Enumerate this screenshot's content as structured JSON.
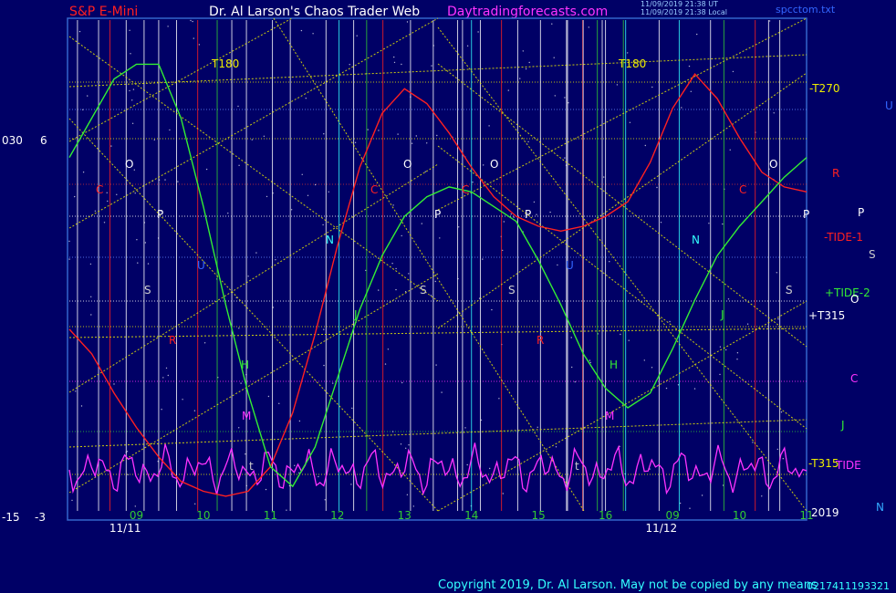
{
  "header": {
    "symbol": "S&P E-Mini",
    "title": "Dr. Al Larson's Chaos Trader Web",
    "site": "Daytradingforecasts.com",
    "stamp1": "11/09/2019 21:38 UT",
    "stamp2": "11/09/2019 21:38 Local",
    "file": "spcctom.txt",
    "copyright": "Copyright 2019, Dr. Al Larson. May not be copied by any means",
    "serial": "0217411193321"
  },
  "colors": {
    "background": "#000066",
    "frame": "#3366cc",
    "grid": "#ffffff",
    "red": "#ff2020",
    "green": "#33ee33",
    "magenta": "#ff33ff",
    "yellow": "#eeee00",
    "cyan": "#33ffff",
    "white": "#ffffff"
  },
  "chart_data": {
    "type": "line",
    "xlim": [
      0,
      33
    ],
    "ylim": [
      -3,
      7
    ],
    "axis_left_outer": [
      "030",
      "-15"
    ],
    "axis_left_inner": [
      "6",
      "-3"
    ],
    "x_ticks": [
      {
        "x": 3,
        "label": "09"
      },
      {
        "x": 6,
        "label": "10"
      },
      {
        "x": 9,
        "label": "11"
      },
      {
        "x": 12,
        "label": "12"
      },
      {
        "x": 15,
        "label": "13"
      },
      {
        "x": 18,
        "label": "14"
      },
      {
        "x": 21,
        "label": "15"
      },
      {
        "x": 24,
        "label": "16"
      },
      {
        "x": 27,
        "label": "09"
      },
      {
        "x": 30,
        "label": "10"
      },
      {
        "x": 33,
        "label": "11"
      }
    ],
    "date_labels": [
      {
        "x": 2.5,
        "label": "11/11"
      },
      {
        "x": 26.5,
        "label": "11/12"
      }
    ],
    "year_label": "2019",
    "series": [
      {
        "name": "TIDE-1",
        "color": "#ff2020",
        "x": [
          0,
          1,
          2,
          3,
          4,
          5,
          6,
          7,
          8,
          9,
          10,
          11,
          12,
          13,
          14,
          15,
          16,
          17,
          18,
          19,
          20,
          21,
          22,
          23,
          24,
          25,
          26,
          27,
          28,
          29,
          30,
          31,
          32,
          33
        ],
        "y": [
          0.7,
          0.2,
          -0.6,
          -1.3,
          -1.9,
          -2.4,
          -2.6,
          -2.7,
          -2.6,
          -2.1,
          -1.0,
          0.6,
          2.4,
          4.0,
          5.1,
          5.6,
          5.3,
          4.7,
          4.0,
          3.4,
          3.0,
          2.8,
          2.7,
          2.8,
          3.0,
          3.3,
          4.1,
          5.2,
          5.9,
          5.4,
          4.6,
          3.9,
          3.6,
          3.5
        ]
      },
      {
        "name": "TIDE-2",
        "color": "#33ee33",
        "x": [
          0,
          1,
          2,
          3,
          4,
          5,
          6,
          7,
          8,
          9,
          10,
          11,
          12,
          13,
          14,
          15,
          16,
          17,
          18,
          19,
          20,
          21,
          22,
          23,
          24,
          25,
          26,
          27,
          28,
          29,
          30,
          31,
          32,
          33
        ],
        "y": [
          4.2,
          5.0,
          5.8,
          6.1,
          6.1,
          5.0,
          3.2,
          1.2,
          -0.6,
          -2.1,
          -2.5,
          -1.7,
          -0.3,
          1.1,
          2.2,
          3.0,
          3.4,
          3.6,
          3.5,
          3.2,
          2.9,
          2.1,
          1.2,
          0.2,
          -0.5,
          -0.9,
          -0.6,
          0.3,
          1.3,
          2.2,
          2.8,
          3.3,
          3.8,
          4.2
        ]
      }
    ],
    "tide_label": "TIDE",
    "right_labels": [
      {
        "text": "-T270",
        "color": "#eeee00"
      },
      {
        "text": "U",
        "color": "#3366ff"
      },
      {
        "text": "R",
        "color": "#ff2020"
      },
      {
        "text": "P",
        "color": "#ffffff"
      },
      {
        "text": "-TIDE-1",
        "color": "#ff2020"
      },
      {
        "text": "S",
        "color": "#cccccc"
      },
      {
        "text": "+TIDE-2",
        "color": "#33ee33"
      },
      {
        "text": "O",
        "color": "#ffffff"
      },
      {
        "text": "+T315",
        "color": "#ffffff"
      },
      {
        "text": "C",
        "color": "#ff33ff"
      },
      {
        "text": "J",
        "color": "#33ee33"
      },
      {
        "text": "-T315",
        "color": "#eeee00"
      },
      {
        "text": "N",
        "color": "#33aaff"
      }
    ],
    "markers": [
      {
        "text": "T180",
        "color": "#eeee00"
      },
      {
        "text": "T180",
        "color": "#eeee00"
      },
      {
        "text": "O",
        "color": "#ffffff"
      },
      {
        "text": "O",
        "color": "#ffffff"
      },
      {
        "text": "O",
        "color": "#ffffff"
      },
      {
        "text": "O",
        "color": "#ffffff"
      },
      {
        "text": "P",
        "color": "#ffffff"
      },
      {
        "text": "P",
        "color": "#ffffff"
      },
      {
        "text": "P",
        "color": "#ffffff"
      },
      {
        "text": "P",
        "color": "#ffffff"
      },
      {
        "text": "S",
        "color": "#cccccc"
      },
      {
        "text": "S",
        "color": "#cccccc"
      },
      {
        "text": "S",
        "color": "#cccccc"
      },
      {
        "text": "S",
        "color": "#cccccc"
      },
      {
        "text": "C",
        "color": "#ff2020"
      },
      {
        "text": "C",
        "color": "#ff2020"
      },
      {
        "text": "C",
        "color": "#ff2020"
      },
      {
        "text": "C",
        "color": "#ff2020"
      },
      {
        "text": "R",
        "color": "#ff2020"
      },
      {
        "text": "R",
        "color": "#ff2020"
      },
      {
        "text": "N",
        "color": "#33ffff"
      },
      {
        "text": "N",
        "color": "#33ffff"
      },
      {
        "text": "J",
        "color": "#33ee33"
      },
      {
        "text": "J",
        "color": "#33ee33"
      },
      {
        "text": "H",
        "color": "#33ee33"
      },
      {
        "text": "H",
        "color": "#33ee33"
      },
      {
        "text": "M",
        "color": "#ff33ff"
      },
      {
        "text": "M",
        "color": "#ff33ff"
      },
      {
        "text": "t",
        "color": "#cccccc"
      },
      {
        "text": "t",
        "color": "#cccccc"
      },
      {
        "text": "U",
        "color": "#3366ff"
      },
      {
        "text": "U",
        "color": "#3366ff"
      }
    ]
  }
}
